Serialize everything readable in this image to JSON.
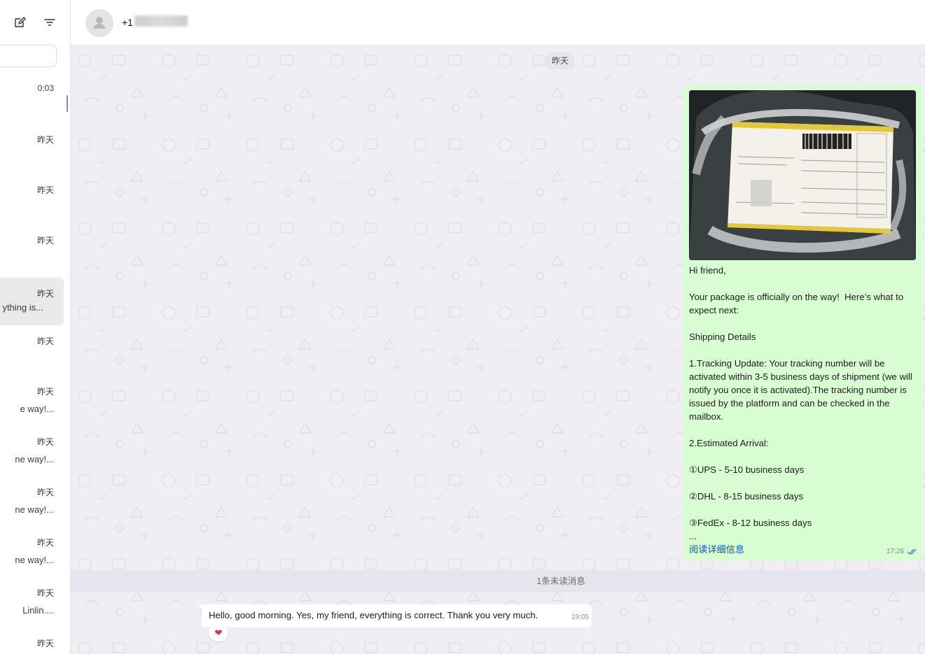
{
  "sidebar": {
    "toolbar": {
      "new_chat_icon": "compose-icon",
      "filter_icon": "filter-icon"
    },
    "search": {
      "placeholder": ""
    },
    "chats": [
      {
        "time": "0:03",
        "preview": "",
        "selected": false
      },
      {
        "time": "昨天",
        "preview": "",
        "selected": false
      },
      {
        "time": "昨天",
        "preview": "",
        "selected": false
      },
      {
        "time": "昨天",
        "preview": "",
        "selected": false
      },
      {
        "time": "昨天",
        "preview": "ything is...",
        "selected": true
      },
      {
        "time": "昨天",
        "preview": "",
        "selected": false
      },
      {
        "time": "昨天",
        "preview": "e way!...",
        "selected": false
      },
      {
        "time": "昨天",
        "preview": "ne way!...",
        "selected": false
      },
      {
        "time": "昨天",
        "preview": "ne way!...",
        "selected": false
      },
      {
        "time": "昨天",
        "preview": "ne way!...",
        "selected": false
      },
      {
        "time": "昨天",
        "preview": "Linlin....",
        "selected": false
      },
      {
        "time": "昨天",
        "preview": "",
        "selected": false
      }
    ]
  },
  "header": {
    "contact_name": "+1",
    "avatar_icon": "default-avatar-icon"
  },
  "conversation": {
    "date_divider": "昨天",
    "outgoing": {
      "image_icon": "package-photo",
      "text": "Hi friend,\n\nYour package is officially on the way!  Here’s what to expect next:\n\nShipping Details\n\n1.Tracking Update: Your tracking number will be activated within 3-5 business days of shipment (we will notify you once it is activated).The tracking number is issued by the platform and can be checked in the mailbox.\n\n2.Estimated Arrival:\n\n①UPS - 5-10 business days\n\n②DHL - 8-15 business days\n\n③FedEx - 8-12 business days\n...",
      "read_more": "阅读详细信息",
      "time": "17:26",
      "status_icon": "double-check-icon"
    },
    "unread_divider": "1条未读消息",
    "incoming": {
      "text": "Hello, good morning. Yes, my friend, everything is correct. Thank you very much.",
      "time": "19:05",
      "reaction": "❤"
    }
  },
  "colors": {
    "outgoing_bubble": "#d9fdd3",
    "chat_background": "#efeef5",
    "link": "#0b57d0",
    "tick": "#3b8bd9"
  }
}
